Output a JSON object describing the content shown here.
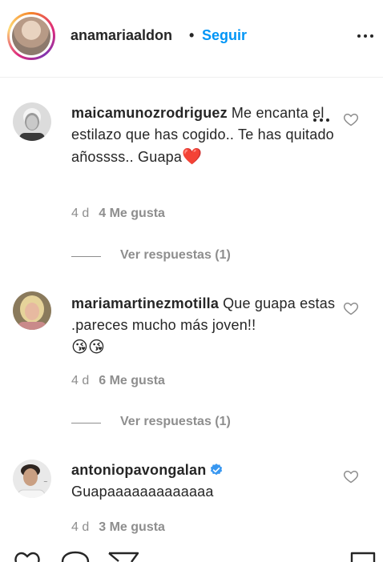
{
  "header": {
    "username": "anamariaaldon",
    "separator": "•",
    "follow_label": "Seguir",
    "more_icon": "more-horizontal-icon"
  },
  "comments": [
    {
      "username": "maicamunozrodriguez",
      "text": "Me encanta el estilazo que has cogido.. Te has quitado añossss.. Guapa",
      "emoji": "❤️",
      "time": "4 d",
      "likes": "4 Me gusta",
      "replies": "Ver respuestas (1)"
    },
    {
      "username": "mariamartinezmotilla",
      "text": "Que guapa estas .pareces mucho más joven!!",
      "emoji": "😘😘",
      "time": "4 d",
      "likes": "6 Me gusta",
      "replies": "Ver respuestas (1)"
    },
    {
      "username": "antoniopavongalan",
      "verified": true,
      "text": "Guapaaaaaaaaaaaaa",
      "time": "4 d",
      "likes": "3 Me gusta"
    }
  ],
  "colors": {
    "accent": "#0095f6",
    "text": "#262626",
    "muted": "#8e8e8e",
    "verified": "#3897f0"
  },
  "icons": [
    "heart-icon",
    "comment-icon",
    "share-icon",
    "bookmark-icon"
  ]
}
